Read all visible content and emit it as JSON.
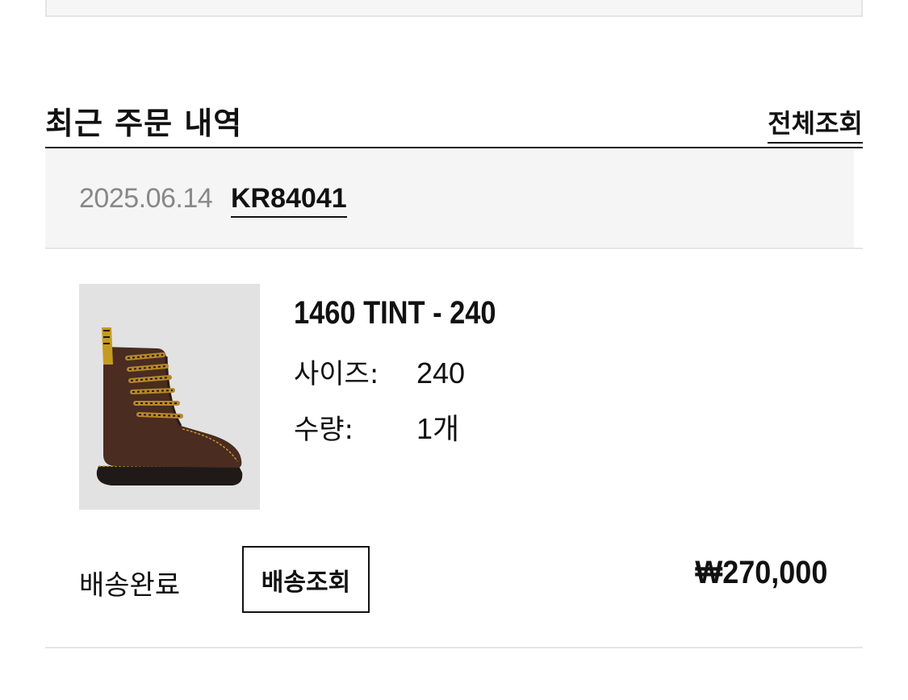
{
  "section": {
    "title": "최근 주문 내역",
    "view_all_label": "전체조회"
  },
  "order": {
    "date": "2025.06.14",
    "order_number": "KR84041",
    "product": {
      "name": "1460 TINT - 240",
      "image_icon": "boot-product-image",
      "size_label": "사이즈:",
      "size_value": "240",
      "quantity_label": "수량:",
      "quantity_value": "1개"
    },
    "status": "배송완료",
    "track_button_label": "배송조회",
    "price": "₩270,000"
  },
  "colors": {
    "text": "#111111",
    "muted": "#888888",
    "meta_background": "#f5f5f5",
    "divider": "#e6e6e6",
    "thumb_background": "#e2e2e2"
  }
}
